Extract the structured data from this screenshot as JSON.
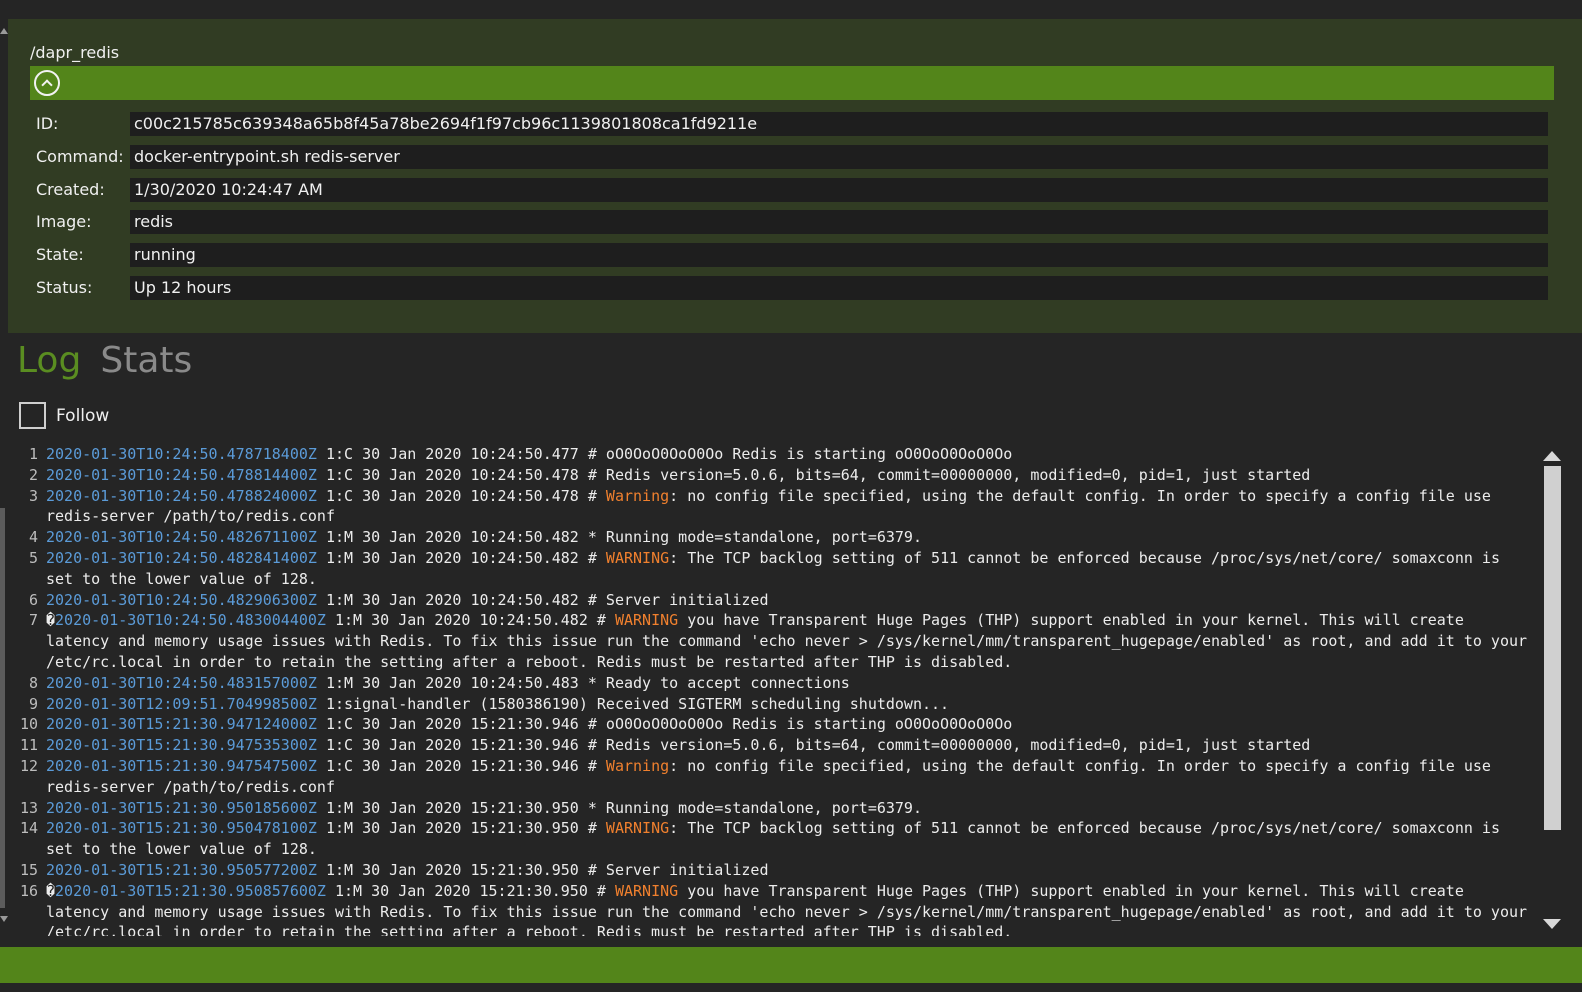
{
  "container": {
    "name": "/dapr_redis",
    "properties": [
      {
        "label": "ID:",
        "value": "c00c215785c639348a65b8f45a78be2694f1f97cb96c1139801808ca1fd9211e"
      },
      {
        "label": "Command:",
        "value": "docker-entrypoint.sh redis-server"
      },
      {
        "label": "Created:",
        "value": "1/30/2020 10:24:47 AM"
      },
      {
        "label": "Image:",
        "value": "redis"
      },
      {
        "label": "State:",
        "value": "running"
      },
      {
        "label": "Status:",
        "value": "Up 12 hours"
      }
    ]
  },
  "tabs": [
    {
      "label": "Log",
      "active": true
    },
    {
      "label": "Stats",
      "active": false
    }
  ],
  "follow": {
    "label": "Follow",
    "checked": false
  },
  "log": {
    "lines": [
      {
        "n": "1",
        "prefix": "",
        "ts": "2020-01-30T10:24:50.478718400Z",
        "pre": " 1:C 30 Jan 2020 10:24:50.477 # oO0OoO0OoO0Oo Redis is starting oO0OoO0OoO0Oo",
        "lvl": "",
        "post": ""
      },
      {
        "n": "2",
        "prefix": "",
        "ts": "2020-01-30T10:24:50.478814400Z",
        "pre": " 1:C 30 Jan 2020 10:24:50.478 # Redis version=5.0.6, bits=64, commit=00000000, modified=0, pid=1, just started",
        "lvl": "",
        "post": ""
      },
      {
        "n": "3",
        "prefix": "",
        "ts": "2020-01-30T10:24:50.478824000Z",
        "pre": " 1:C 30 Jan 2020 10:24:50.478 # ",
        "lvl": "Warning",
        "post": ": no config file specified, using the default config. In order to specify a config file use redis-server /path/to/redis.conf"
      },
      {
        "n": "4",
        "prefix": "",
        "ts": "2020-01-30T10:24:50.482671100Z",
        "pre": " 1:M 30 Jan 2020 10:24:50.482 * Running mode=standalone, port=6379.",
        "lvl": "",
        "post": ""
      },
      {
        "n": "5",
        "prefix": "",
        "ts": "2020-01-30T10:24:50.482841400Z",
        "pre": " 1:M 30 Jan 2020 10:24:50.482 # ",
        "lvl": "WARNING",
        "post": ": The TCP backlog setting of 511 cannot be enforced because /proc/sys/net/core/ somaxconn is set to the lower value of 128."
      },
      {
        "n": "6",
        "prefix": "",
        "ts": "2020-01-30T10:24:50.482906300Z",
        "pre": " 1:M 30 Jan 2020 10:24:50.482 # Server initialized",
        "lvl": "",
        "post": ""
      },
      {
        "n": "7",
        "prefix": "�",
        "ts": "2020-01-30T10:24:50.483004400Z",
        "pre": " 1:M 30 Jan 2020 10:24:50.482 # ",
        "lvl": "WARNING",
        "post": " you have Transparent Huge Pages (THP) support enabled in your kernel. This will create latency and memory usage issues with Redis. To fix this issue run the command 'echo never > /sys/kernel/mm/transparent_hugepage/enabled' as root, and add it to your /etc/rc.local in order to retain the setting after a reboot. Redis must be restarted after THP is disabled."
      },
      {
        "n": "8",
        "prefix": "",
        "ts": "2020-01-30T10:24:50.483157000Z",
        "pre": " 1:M 30 Jan 2020 10:24:50.483 * Ready to accept connections",
        "lvl": "",
        "post": ""
      },
      {
        "n": "9",
        "prefix": "",
        "ts": "2020-01-30T12:09:51.704998500Z",
        "pre": " 1:signal-handler (1580386190) Received SIGTERM scheduling shutdown...",
        "lvl": "",
        "post": ""
      },
      {
        "n": "10",
        "prefix": "",
        "ts": "2020-01-30T15:21:30.947124000Z",
        "pre": " 1:C 30 Jan 2020 15:21:30.946 # oO0OoO0OoO0Oo Redis is starting oO0OoO0OoO0Oo",
        "lvl": "",
        "post": ""
      },
      {
        "n": "11",
        "prefix": "",
        "ts": "2020-01-30T15:21:30.947535300Z",
        "pre": " 1:C 30 Jan 2020 15:21:30.946 # Redis version=5.0.6, bits=64, commit=00000000, modified=0, pid=1, just started",
        "lvl": "",
        "post": ""
      },
      {
        "n": "12",
        "prefix": "",
        "ts": "2020-01-30T15:21:30.947547500Z",
        "pre": " 1:C 30 Jan 2020 15:21:30.946 # ",
        "lvl": "Warning",
        "post": ": no config file specified, using the default config. In order to specify a config file use redis-server /path/to/redis.conf"
      },
      {
        "n": "13",
        "prefix": "",
        "ts": "2020-01-30T15:21:30.950185600Z",
        "pre": " 1:M 30 Jan 2020 15:21:30.950 * Running mode=standalone, port=6379.",
        "lvl": "",
        "post": ""
      },
      {
        "n": "14",
        "prefix": "",
        "ts": "2020-01-30T15:21:30.950478100Z",
        "pre": " 1:M 30 Jan 2020 15:21:30.950 # ",
        "lvl": "WARNING",
        "post": ": The TCP backlog setting of 511 cannot be enforced because /proc/sys/net/core/ somaxconn is set to the lower value of 128."
      },
      {
        "n": "15",
        "prefix": "",
        "ts": "2020-01-30T15:21:30.950577200Z",
        "pre": " 1:M 30 Jan 2020 15:21:30.950 # Server initialized",
        "lvl": "",
        "post": ""
      },
      {
        "n": "16",
        "prefix": "�",
        "ts": "2020-01-30T15:21:30.950857600Z",
        "pre": " 1:M 30 Jan 2020 15:21:30.950 # ",
        "lvl": "WARNING",
        "post": " you have Transparent Huge Pages (THP) support enabled in your kernel. This will create latency and memory usage issues with Redis. To fix this issue run the command 'echo never > /sys/kernel/mm/transparent_hugepage/enabled' as root, and add it to your /etc/rc.local in order to retain the setting after a reboot. Redis must be restarted after THP is disabled."
      }
    ]
  },
  "colors": {
    "accent": "#53851a",
    "panel": "#313c23",
    "timestamp": "#5b9bd8",
    "warning": "#f0802e",
    "tab_active": "#5a8d21"
  },
  "icons": {
    "collapse": "chevron-up-circle-icon"
  }
}
